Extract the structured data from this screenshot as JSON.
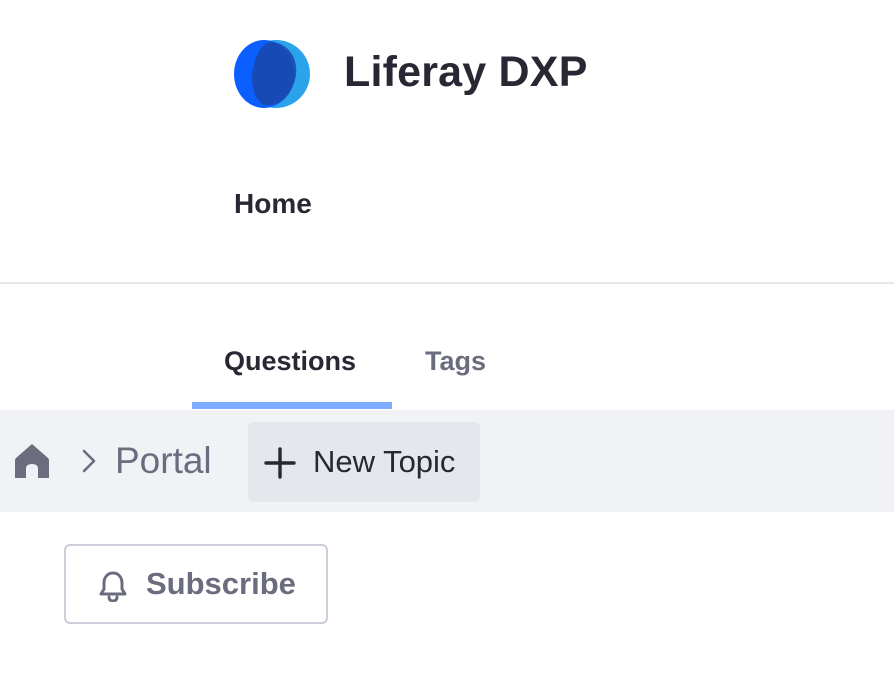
{
  "header": {
    "site_title": "Liferay DXP",
    "logo_icon": "liferay-logo-icon",
    "nav": [
      {
        "label": "Home"
      }
    ]
  },
  "tabs": [
    {
      "label": "Questions",
      "active": true
    },
    {
      "label": "Tags",
      "active": false
    }
  ],
  "breadcrumb": {
    "home_icon": "home-icon",
    "separator_icon": "chevron-right-icon",
    "items": [
      {
        "label": "Portal"
      }
    ]
  },
  "toolbar": {
    "new_topic_label": "New Topic",
    "new_topic_icon": "plus-icon"
  },
  "actions": {
    "subscribe_label": "Subscribe",
    "subscribe_icon": "bell-icon"
  },
  "colors": {
    "text_primary": "#272833",
    "text_secondary": "#6b6c7e",
    "tab_indicator": "#80acff",
    "breadcrumb_bg": "#f1f2f5",
    "logo_light_blue": "#2ba3ec",
    "logo_dark_blue": "#0b5fff"
  }
}
